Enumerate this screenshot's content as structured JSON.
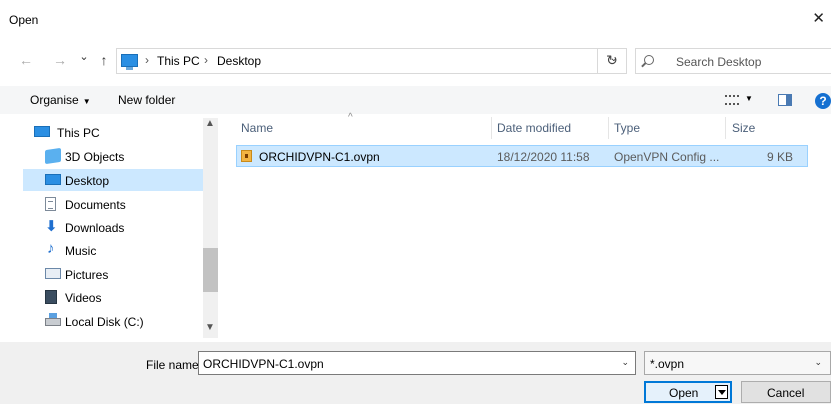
{
  "window": {
    "title": "Open",
    "close_glyph": "✕"
  },
  "nav": {
    "back_glyph": "←",
    "forward_glyph": "→",
    "recent_glyph": "⌄",
    "up_glyph": "↑",
    "address": [
      "This PC",
      "Desktop"
    ],
    "address_sep": "›",
    "dropdown_glyph": "⌄",
    "refresh_glyph": "↻",
    "search_placeholder": "Search Desktop"
  },
  "toolbar": {
    "organise_label": "Organise",
    "organise_caret": "▼",
    "new_folder_label": "New folder",
    "view_caret": "▼",
    "help_glyph": "?"
  },
  "navpane": {
    "items": [
      {
        "label": "This PC",
        "icon": "pc-icon"
      },
      {
        "label": "3D Objects",
        "icon": "3d-objects-icon"
      },
      {
        "label": "Desktop",
        "icon": "desktop-icon",
        "selected": true
      },
      {
        "label": "Documents",
        "icon": "documents-icon"
      },
      {
        "label": "Downloads",
        "icon": "downloads-icon"
      },
      {
        "label": "Music",
        "icon": "music-icon"
      },
      {
        "label": "Pictures",
        "icon": "pictures-icon"
      },
      {
        "label": "Videos",
        "icon": "videos-icon"
      },
      {
        "label": "Local Disk (C:)",
        "icon": "local-disk-icon"
      }
    ],
    "downloads_glyph": "⬇",
    "music_glyph": "♪"
  },
  "filelist": {
    "columns": [
      "Name",
      "Date modified",
      "Type",
      "Size"
    ],
    "sort_glyph": "^",
    "rows": [
      {
        "name": "ORCHIDVPN-C1.ovpn",
        "date": "18/12/2020 11:58",
        "type": "OpenVPN Config ...",
        "size": "9 KB"
      }
    ]
  },
  "footer": {
    "filename_label": "File name:",
    "filename_value": "ORCHIDVPN-C1.ovpn",
    "filter_value": "*.ovpn",
    "dropdown_glyph": "⌄",
    "open_label": "Open",
    "cancel_label": "Cancel"
  },
  "colors": {
    "selection": "#cce8ff",
    "accent": "#0078d7"
  }
}
